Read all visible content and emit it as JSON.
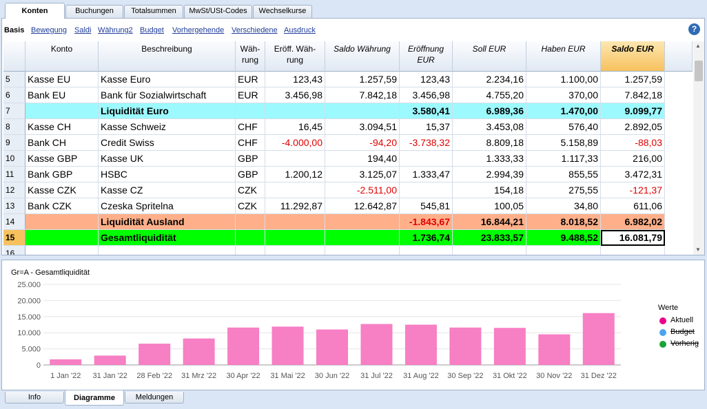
{
  "top_tabs": [
    "Konten",
    "Buchungen",
    "Totalsummen",
    "MwSt/USt-Codes",
    "Wechselkurse"
  ],
  "subnav": {
    "basis": "Basis",
    "links": [
      "Bewegung",
      "Saldi",
      "Währung2",
      "Budget",
      "Vorhergehende",
      "Verschiedene",
      "Ausdruck"
    ]
  },
  "help_label": "?",
  "table": {
    "headers": [
      "Konto",
      "Beschreibung",
      "Wäh-\nrung",
      "Eröff. Wäh-\nrung",
      "Saldo Währung",
      "Eröffnung\nEUR",
      "Soll EUR",
      "Haben EUR",
      "Saldo EUR"
    ],
    "rows": [
      {
        "n": "5",
        "konto": "Kasse EU",
        "beschr": "Kasse Euro",
        "wahr": "EUR",
        "eroffw": "123,43",
        "saldow": "1.257,59",
        "eroffeur": "123,43",
        "soll": "2.234,16",
        "haben": "1.100,00",
        "saldo": "1.257,59"
      },
      {
        "n": "6",
        "konto": "Bank EU",
        "beschr": "Bank für Sozialwirtschaft",
        "wahr": "EUR",
        "eroffw": "3.456,98",
        "saldow": "7.842,18",
        "eroffeur": "3.456,98",
        "soll": "4.755,20",
        "haben": "370,00",
        "saldo": "7.842,18"
      },
      {
        "n": "7",
        "konto": "",
        "beschr": "Liquidität Euro",
        "wahr": "",
        "eroffw": "",
        "saldow": "",
        "eroffeur": "3.580,41",
        "soll": "6.989,36",
        "haben": "1.470,00",
        "saldo": "9.099,77"
      },
      {
        "n": "8",
        "konto": "Kasse CH",
        "beschr": "Kasse Schweiz",
        "wahr": "CHF",
        "eroffw": "16,45",
        "saldow": "3.094,51",
        "eroffeur": "15,37",
        "soll": "3.453,08",
        "haben": "576,40",
        "saldo": "2.892,05"
      },
      {
        "n": "9",
        "konto": "Bank CH",
        "beschr": "Credit Swiss",
        "wahr": "CHF",
        "eroffw": "-4.000,00",
        "saldow": "-94,20",
        "eroffeur": "-3.738,32",
        "soll": "8.809,18",
        "haben": "5.158,89",
        "saldo": "-88,03"
      },
      {
        "n": "10",
        "konto": "Kasse GBP",
        "beschr": "Kasse UK",
        "wahr": "GBP",
        "eroffw": "",
        "saldow": "194,40",
        "eroffeur": "",
        "soll": "1.333,33",
        "haben": "1.117,33",
        "saldo": "216,00"
      },
      {
        "n": "11",
        "konto": "Bank GBP",
        "beschr": "HSBC",
        "wahr": "GBP",
        "eroffw": "1.200,12",
        "saldow": "3.125,07",
        "eroffeur": "1.333,47",
        "soll": "2.994,39",
        "haben": "855,55",
        "saldo": "3.472,31"
      },
      {
        "n": "12",
        "konto": "Kasse CZK",
        "beschr": "Kasse CZ",
        "wahr": "CZK",
        "eroffw": "",
        "saldow": "-2.511,00",
        "eroffeur": "",
        "soll": "154,18",
        "haben": "275,55",
        "saldo": "-121,37"
      },
      {
        "n": "13",
        "konto": "Bank CZK",
        "beschr": "Czeska Spritelna",
        "wahr": "CZK",
        "eroffw": "11.292,87",
        "saldow": "12.642,87",
        "eroffeur": "545,81",
        "soll": "100,05",
        "haben": "34,80",
        "saldo": "611,06"
      },
      {
        "n": "14",
        "konto": "",
        "beschr": "Liquidität Ausland",
        "wahr": "",
        "eroffw": "",
        "saldow": "",
        "eroffeur": "-1.843,67",
        "soll": "16.844,21",
        "haben": "8.018,52",
        "saldo": "6.982,02"
      },
      {
        "n": "15",
        "konto": "",
        "beschr": "Gesamtliquidität",
        "wahr": "",
        "eroffw": "",
        "saldow": "",
        "eroffeur": "1.736,74",
        "soll": "23.833,57",
        "haben": "9.488,52",
        "saldo": "16.081,79"
      },
      {
        "n": "16",
        "konto": "",
        "beschr": "",
        "wahr": "",
        "eroffw": "",
        "saldow": "",
        "eroffeur": "",
        "soll": "",
        "haben": "",
        "saldo": ""
      }
    ],
    "row_styles": {
      "7": "#9cfaff",
      "14": "#ffb08a",
      "15": "#00ff00"
    },
    "header_saldo_color": "#f7c15e",
    "negative_color": "#e00000"
  },
  "chart_title": "Gr=A - Gesamtliquidität",
  "chart_data": {
    "type": "bar",
    "title": "Gr=A - Gesamtliquidität",
    "categories": [
      "1 Jan '22",
      "31 Jan '22",
      "28 Feb '22",
      "31 Mrz '22",
      "30 Apr '22",
      "31 Mai '22",
      "30 Jun '22",
      "31 Jul '22",
      "31 Aug '22",
      "30 Sep '22",
      "31 Okt '22",
      "30 Nov '22",
      "31 Dez '22"
    ],
    "series": [
      {
        "name": "Aktuell",
        "color": "#f77fc4",
        "values": [
          1737,
          2900,
          6600,
          8200,
          11600,
          11900,
          11000,
          12700,
          12500,
          11600,
          11500,
          9500,
          16082
        ]
      }
    ],
    "ylim": [
      0,
      25000
    ],
    "yticks": [
      "0",
      "5.000",
      "10.000",
      "15.000",
      "20.000",
      "25.000"
    ],
    "yvals": [
      0,
      5000,
      10000,
      15000,
      20000,
      25000
    ],
    "grid": true,
    "legend_position": "right"
  },
  "legend": {
    "title": "Werte",
    "items": [
      {
        "label": "Aktuell",
        "color": "#ec008c",
        "struck": false
      },
      {
        "label": "Budget",
        "color": "#4aa3f0",
        "struck": true
      },
      {
        "label": "Vorherig",
        "color": "#1aa33a",
        "struck": true
      }
    ]
  },
  "bottom_tabs": [
    "Info",
    "Diagramme",
    "Meldungen"
  ]
}
